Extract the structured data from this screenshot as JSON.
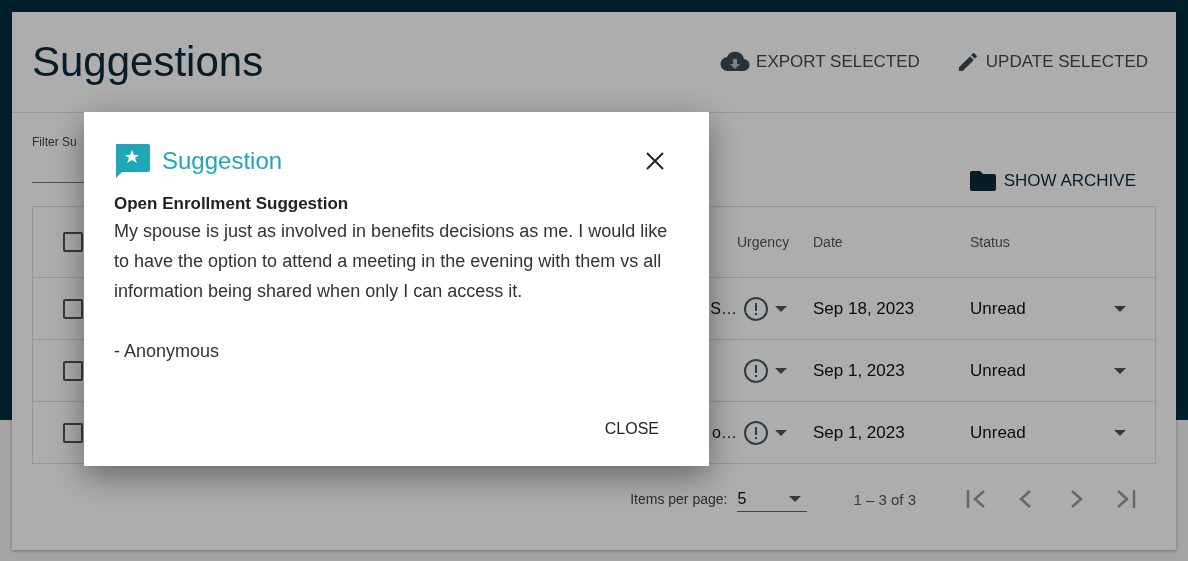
{
  "page": {
    "title": "Suggestions",
    "actions": [
      {
        "kind": "export",
        "label": "EXPORT SELECTED"
      },
      {
        "kind": "update",
        "label": "UPDATE SELECTED"
      }
    ]
  },
  "filter": {
    "label": "Filter Su"
  },
  "archive_button": {
    "label": "SHOW ARCHIVE"
  },
  "table": {
    "select_all_checked": false,
    "columns": [
      "Urgency",
      "Date",
      "Status"
    ],
    "rows": [
      {
        "checked": false,
        "suggestion": "S…",
        "date": "Sep 18, 2023",
        "status": "Unread"
      },
      {
        "checked": false,
        "date": "Sep 1, 2023",
        "status": "Unread"
      },
      {
        "checked": false,
        "suggestion": "o…",
        "date": "Sep 1, 2023",
        "status": "Unread"
      }
    ]
  },
  "paginator": {
    "label": "Items per page:",
    "page_size": "5",
    "range": "1 – 3 of 3"
  },
  "dialog": {
    "title": "Suggestion",
    "heading": "Open Enrollment Suggestion",
    "message": "My spouse is just as involved in benefits decisions as me. I would like to have the option to attend a meeting in the evening with them vs all information being shared when only I can access it.",
    "signature": "- Anonymous",
    "close_button": "CLOSE"
  }
}
